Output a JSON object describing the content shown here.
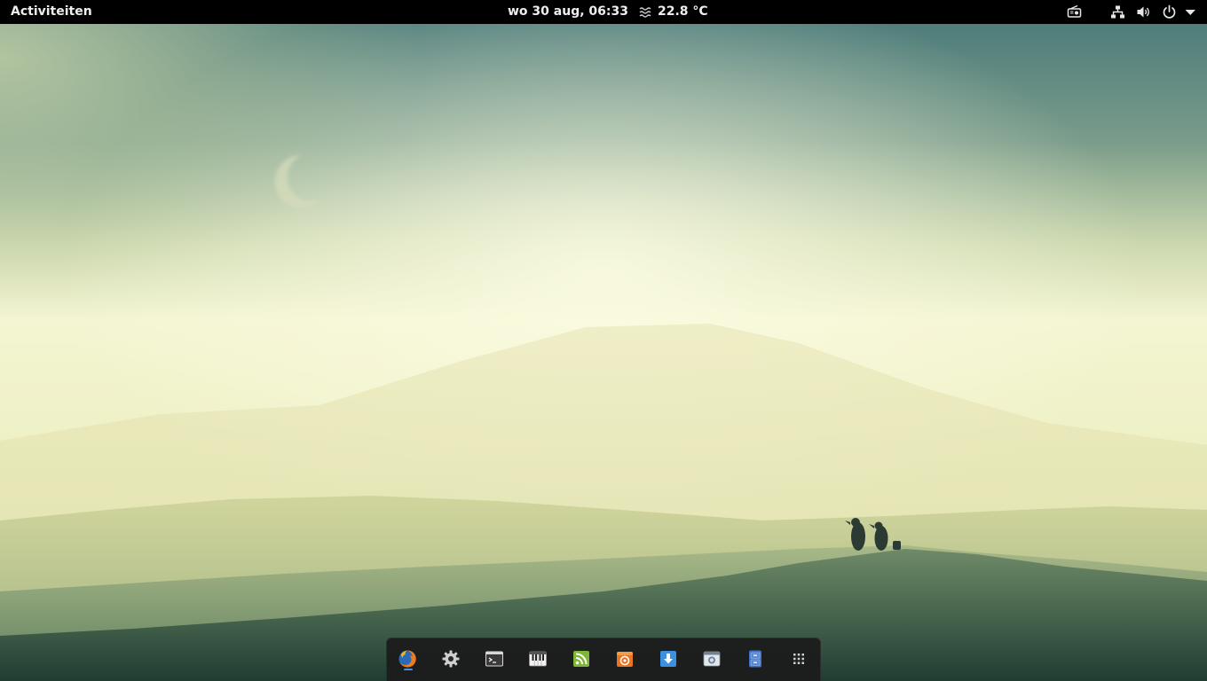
{
  "topbar": {
    "activities_label": "Activiteiten",
    "clock": "wo 30 aug, 06:33",
    "weather": {
      "icon": "fog-icon",
      "temperature": "22.8 °C"
    },
    "tray": [
      {
        "name": "radio-icon"
      },
      {
        "name": "network-wired-icon"
      },
      {
        "name": "volume-icon"
      },
      {
        "name": "power-icon"
      },
      {
        "name": "chevron-down-icon"
      }
    ]
  },
  "dock": {
    "items": [
      {
        "name": "firefox-icon",
        "app": "firefox",
        "running": true
      },
      {
        "name": "settings-gear-icon",
        "app": "settings"
      },
      {
        "name": "terminal-icon",
        "app": "terminal"
      },
      {
        "name": "piano-icon",
        "app": "piano"
      },
      {
        "name": "rss-icon",
        "app": "feed-reader"
      },
      {
        "name": "software-center-icon",
        "app": "software-center"
      },
      {
        "name": "download-icon",
        "app": "downloader"
      },
      {
        "name": "screenshot-icon",
        "app": "screenshot"
      },
      {
        "name": "file-cabinet-icon",
        "app": "archive"
      },
      {
        "name": "app-grid-icon",
        "app": "show-applications"
      }
    ]
  },
  "colors": {
    "topbar_bg": "#000000",
    "dock_bg": "#1c1c1c",
    "running_indicator": "#4a90d9",
    "sky_top": "#4f7d7b",
    "haze": "#f6f6d6",
    "hills_dark": "#1f3e32"
  }
}
